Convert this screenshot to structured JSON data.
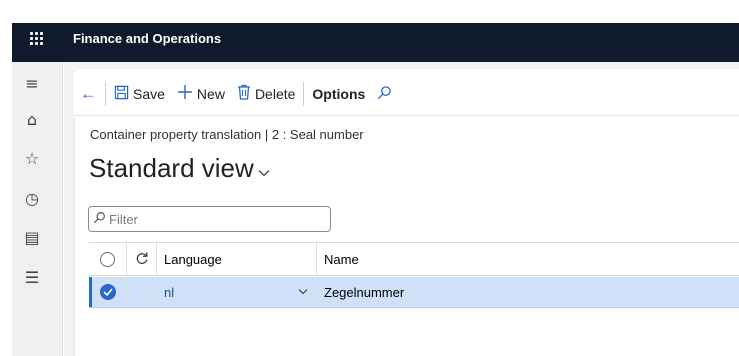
{
  "app": {
    "title": "Finance and Operations"
  },
  "nav": {
    "items": [
      {
        "icon": "hamburger-icon",
        "glyph": "≡"
      },
      {
        "icon": "home-icon",
        "glyph": "⌂"
      },
      {
        "icon": "star-icon",
        "glyph": "☆"
      },
      {
        "icon": "clock-icon",
        "glyph": "◷"
      },
      {
        "icon": "workspace-icon",
        "glyph": "▤"
      },
      {
        "icon": "modules-list-icon",
        "glyph": "☰"
      }
    ]
  },
  "toolbar": {
    "back_glyph": "←",
    "save_label": "Save",
    "new_label": "New",
    "delete_label": "Delete",
    "options_label": "Options"
  },
  "breadcrumb": {
    "text": "Container property translation  |  2 : Seal number"
  },
  "page": {
    "title": "Standard view"
  },
  "filter": {
    "placeholder": "Filter",
    "value": ""
  },
  "grid": {
    "columns": {
      "language": "Language",
      "name": "Name"
    },
    "rows": [
      {
        "language": "nl",
        "name": "Zegelnummer",
        "selected": true
      }
    ]
  },
  "colors": {
    "topbar": "#0f1b2d",
    "accent": "#2a67c8",
    "selected_row": "#cfe1f8"
  }
}
